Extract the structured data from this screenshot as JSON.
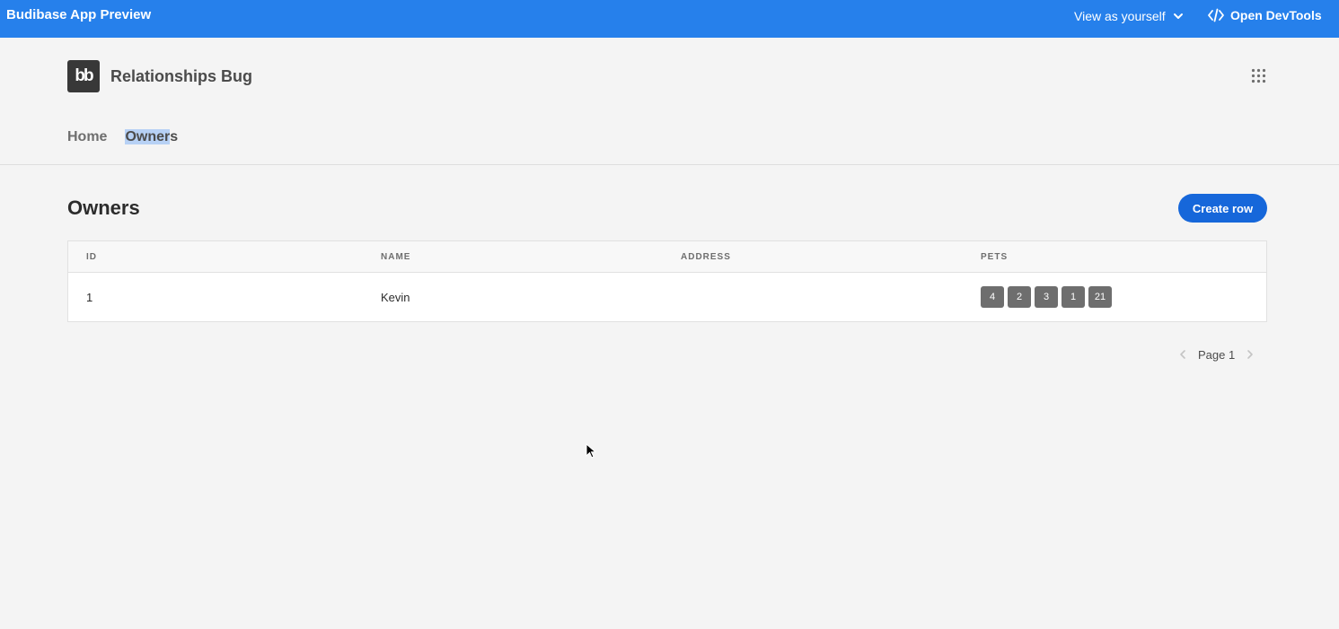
{
  "preview_bar": {
    "title": "Budibase App Preview",
    "view_as_label": "View as yourself",
    "devtools_label": "Open DevTools",
    "icons": {
      "view_as": "chevron-down-icon",
      "devtools": "code-icon"
    }
  },
  "app": {
    "logo_text": "bb",
    "title": "Relationships Bug",
    "apps_icon": "grid-icon"
  },
  "nav": {
    "items": [
      {
        "label": "Home"
      },
      {
        "label_selected": "Owner",
        "label_rest": "s"
      }
    ]
  },
  "page": {
    "title": "Owners",
    "create_button": "Create row"
  },
  "table": {
    "columns": [
      "ID",
      "NAME",
      "ADDRESS",
      "PETS"
    ],
    "rows": [
      {
        "id": "1",
        "name": "Kevin",
        "address": "",
        "pets": [
          "4",
          "2",
          "3",
          "1",
          "21"
        ]
      }
    ]
  },
  "pagination": {
    "label": "Page 1",
    "icons": {
      "prev": "chevron-left-icon",
      "next": "chevron-right-icon"
    }
  },
  "colors": {
    "preview_bar": "#2680eb",
    "primary_button": "#1667da",
    "pill": "#6e6e6e",
    "background": "#f4f4f4"
  }
}
